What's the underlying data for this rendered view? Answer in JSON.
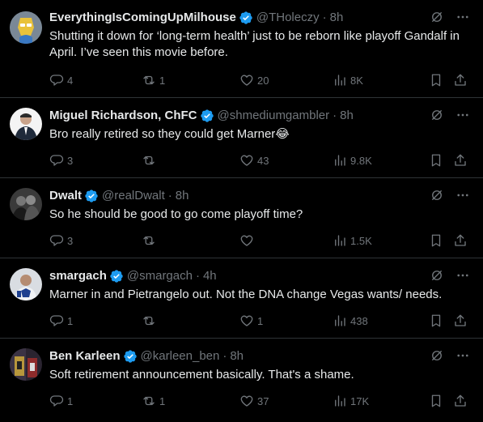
{
  "colors": {
    "background": "#000000",
    "text": "#e7e9ea",
    "muted": "#71767b",
    "verified": "#1d9bf0",
    "divider": "#2f3336"
  },
  "icons": {
    "reply": "reply-icon",
    "retweet": "retweet-icon",
    "like": "heart-icon",
    "views": "views-icon",
    "bookmark": "bookmark-icon",
    "share": "share-icon",
    "verified": "verified-badge-icon",
    "grok": "grok-icon",
    "more": "more-icon"
  },
  "tweets": [
    {
      "name": "EverythingIsComingUpMilhouse",
      "handle": "@THoleczy",
      "time": "8h",
      "text": "Shutting it down for ‘long-term health’ just to be reborn like playoff Gandalf in April. I’ve seen this movie before.",
      "replies": "4",
      "retweets": "1",
      "likes": "20",
      "views": "8K"
    },
    {
      "name": "Miguel Richardson, ChFC",
      "handle": "@shmediumgambler",
      "time": "8h",
      "text": "Bro really retired so they could get Marner😂",
      "replies": "3",
      "retweets": "",
      "likes": "43",
      "views": "9.8K"
    },
    {
      "name": "Dwalt",
      "handle": "@realDwalt",
      "time": "8h",
      "text": "So he should be good to go come playoff time?",
      "replies": "3",
      "retweets": "",
      "likes": "",
      "views": "1.5K"
    },
    {
      "name": "smargach",
      "handle": "@smargach",
      "time": "4h",
      "text": "Marner in and Pietrangelo out. Not the DNA change Vegas wants/ needs.",
      "replies": "1",
      "retweets": "",
      "likes": "1",
      "views": "438"
    },
    {
      "name": "Ben Karleen",
      "handle": "@karleen_ben",
      "time": "8h",
      "text": "Soft retirement announcement basically. That's a shame.",
      "replies": "1",
      "retweets": "1",
      "likes": "37",
      "views": "17K"
    }
  ]
}
